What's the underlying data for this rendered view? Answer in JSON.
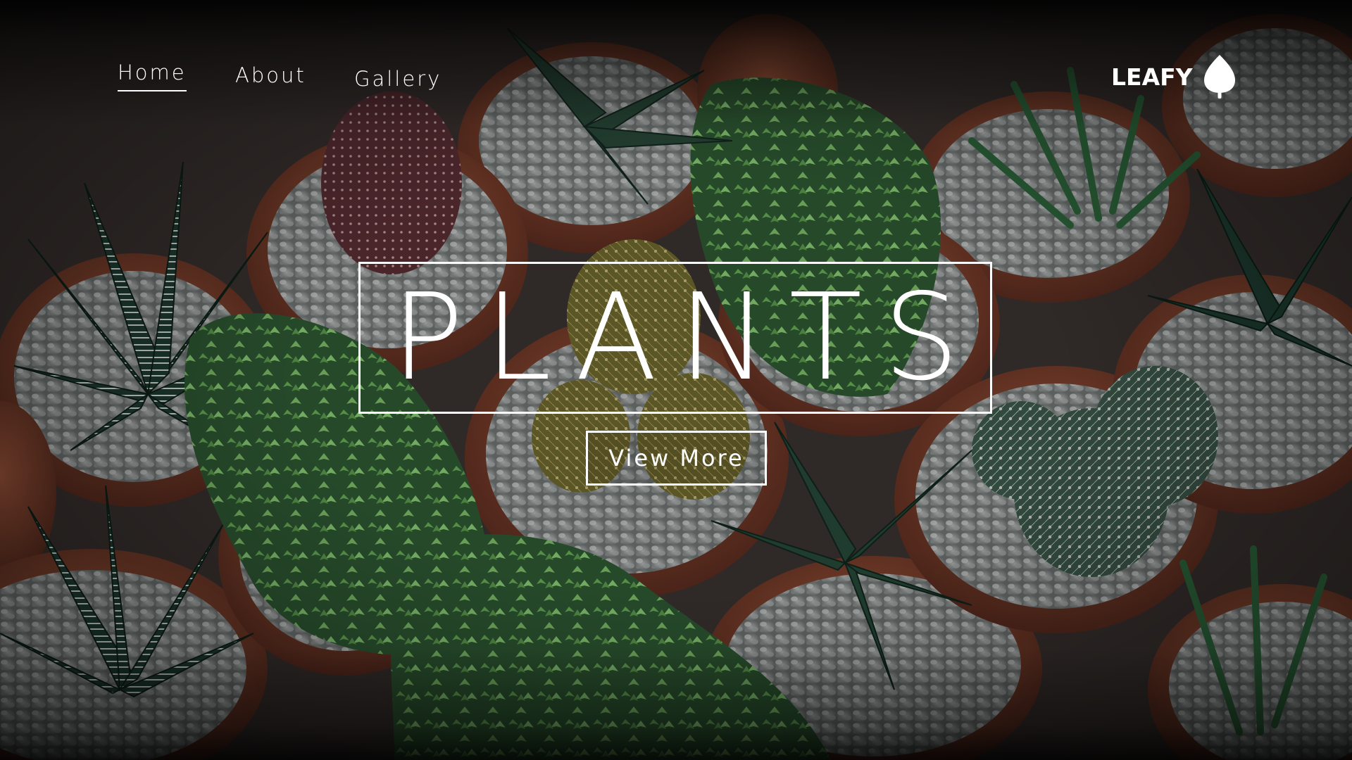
{
  "nav": {
    "items": [
      {
        "label": "Home",
        "active": true
      },
      {
        "label": "About",
        "active": false
      },
      {
        "label": "Gallery",
        "active": false
      }
    ]
  },
  "brand": {
    "name": "LEAFY",
    "icon": "leaf-icon"
  },
  "hero": {
    "title": "PLANTS",
    "cta_label": "View More"
  },
  "colors": {
    "text": "#ffffff",
    "pot": "#8a4a34",
    "succulent_light": "#6fae5c",
    "succulent_dark": "#2f4f3e",
    "gravel": "#9aa0a0"
  }
}
